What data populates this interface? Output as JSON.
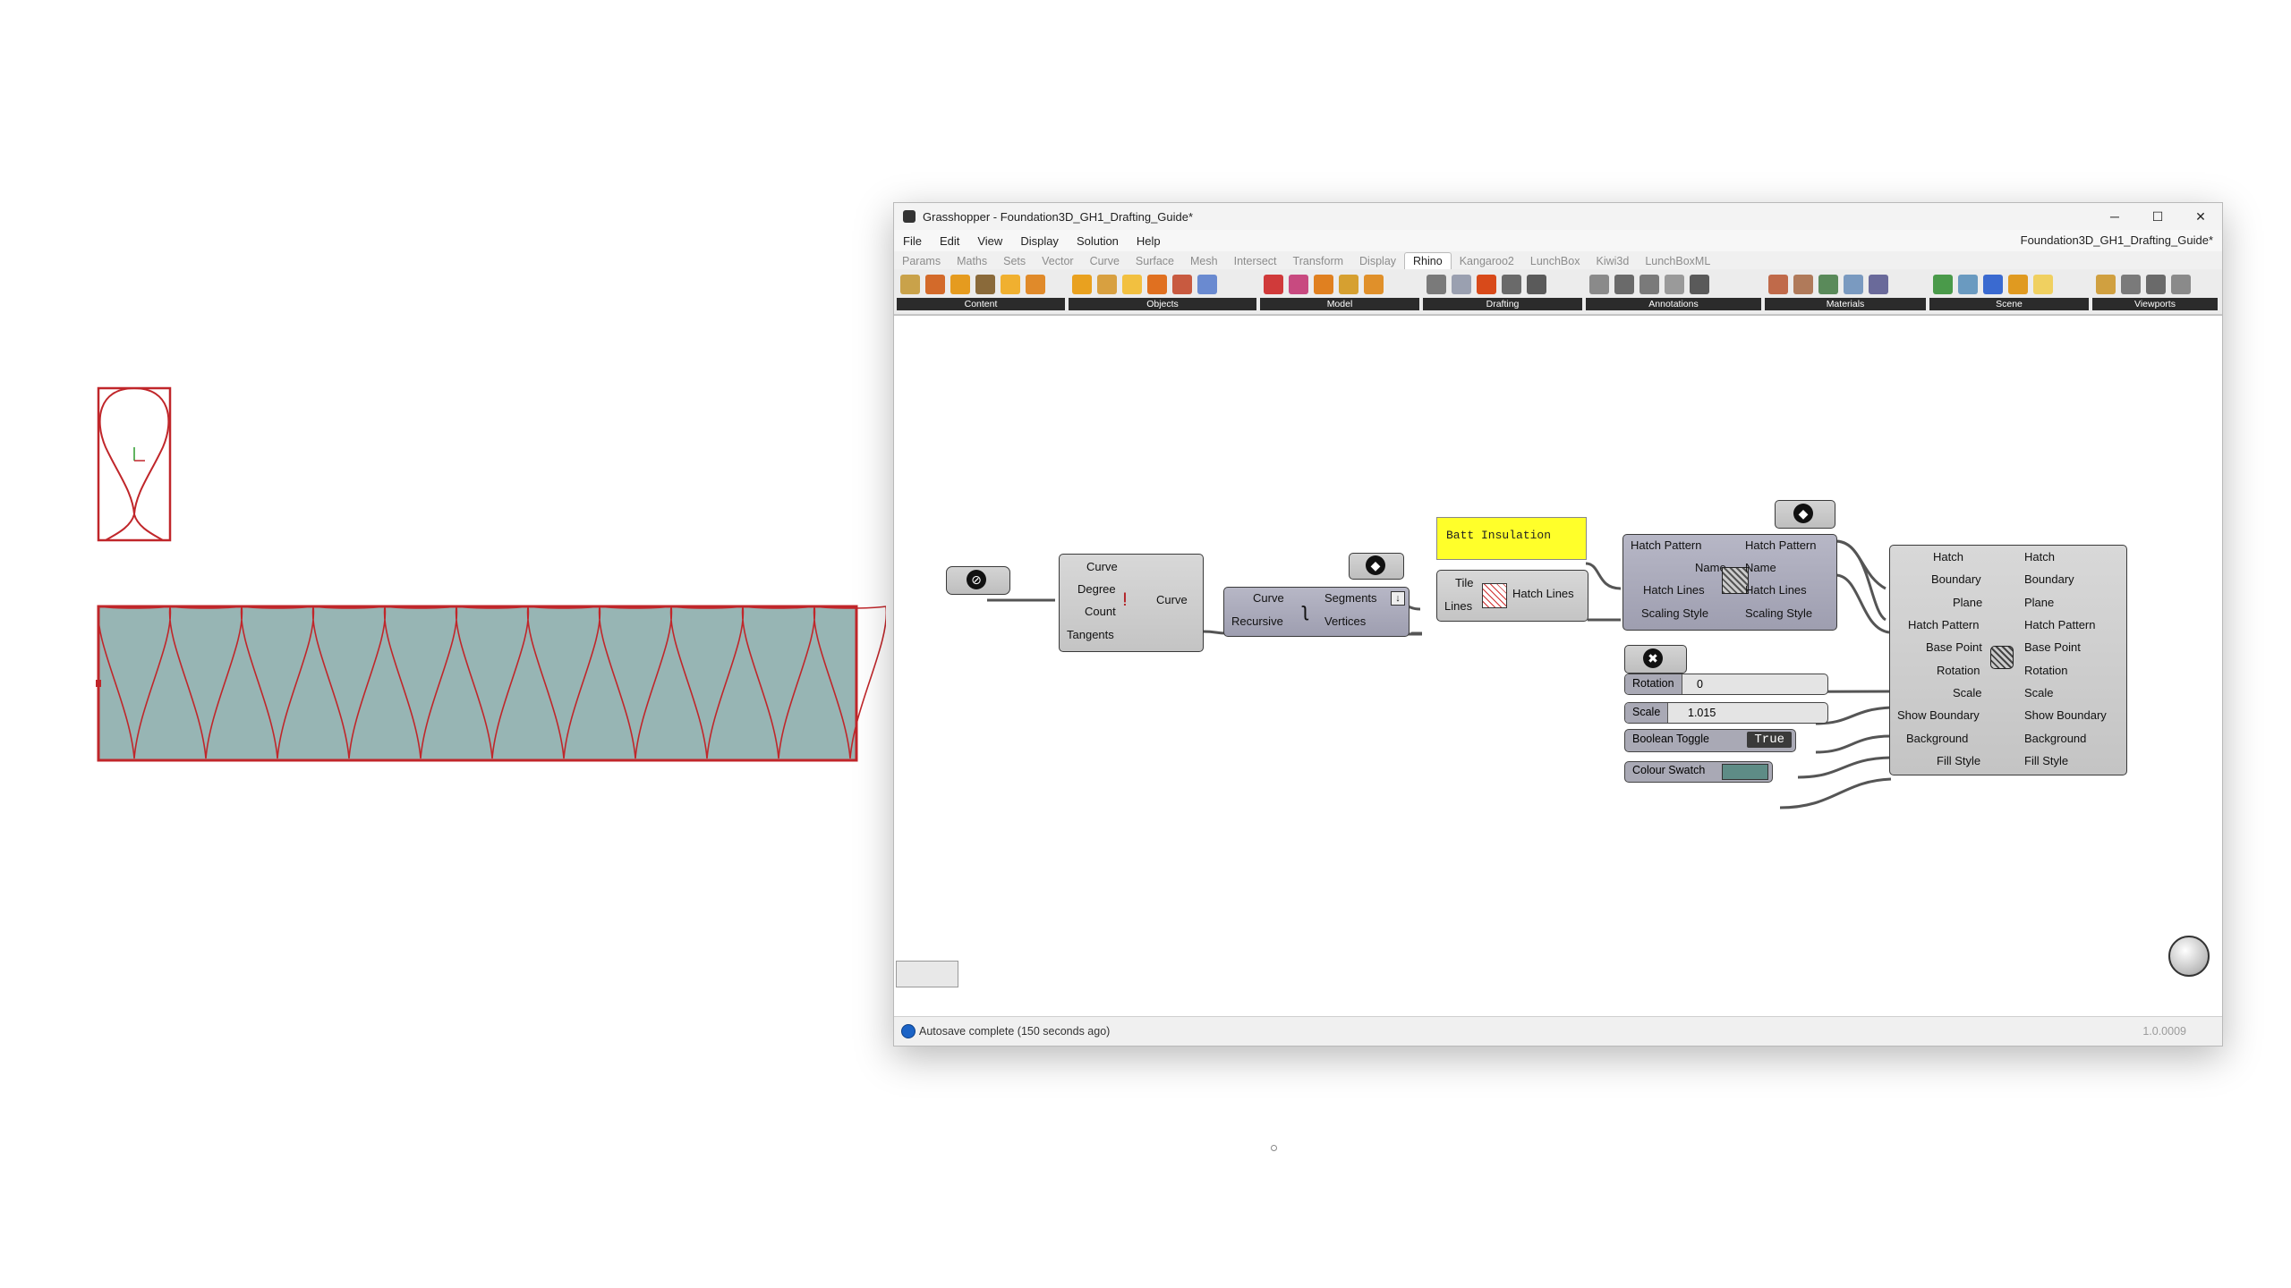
{
  "window": {
    "title": "Grasshopper - Foundation3D_GH1_Drafting_Guide*",
    "doc_name": "Foundation3D_GH1_Drafting_Guide*",
    "controls": {
      "minimize": "─",
      "maximize": "☐",
      "close": "✕"
    }
  },
  "menu": [
    "File",
    "Edit",
    "View",
    "Display",
    "Solution",
    "Help"
  ],
  "tabs": [
    "Params",
    "Maths",
    "Sets",
    "Vector",
    "Curve",
    "Surface",
    "Mesh",
    "Intersect",
    "Transform",
    "Display",
    "Rhino",
    "Kangaroo2",
    "LunchBox",
    "Kiwi3d",
    "LunchBoxML"
  ],
  "active_tab": "Rhino",
  "toolbar_groups": [
    "Content",
    "Objects",
    "Model",
    "Drafting",
    "Annotations",
    "Materials",
    "Scene",
    "Viewports"
  ],
  "canvas": {
    "panel_text": "Batt Insulation",
    "nurbs": {
      "inputs": [
        "Curve",
        "Degree",
        "Count",
        "Tangents"
      ],
      "output": "Curve"
    },
    "explode": {
      "inputs": [
        "Curve",
        "Recursive"
      ],
      "outputs": [
        "Segments",
        "Vertices"
      ]
    },
    "hatch_lines": {
      "inputs": [
        "Tile",
        "Lines"
      ],
      "output": "Hatch Lines"
    },
    "hatch_pattern": {
      "inputs": [
        "Hatch Pattern",
        "Name",
        "Hatch Lines",
        "Scaling Style"
      ],
      "outputs": [
        "Hatch Pattern",
        "Name",
        "Hatch Lines",
        "Scaling Style"
      ]
    },
    "model_hatch": {
      "inputs": [
        "Hatch",
        "Boundary",
        "Plane",
        "Hatch Pattern",
        "Base Point",
        "Rotation",
        "Scale",
        "Show Boundary",
        "Background",
        "Fill Style"
      ],
      "outputs": [
        "Hatch",
        "Boundary",
        "Plane",
        "Hatch Pattern",
        "Base Point",
        "Rotation",
        "Scale",
        "Show Boundary",
        "Background",
        "Fill Style"
      ]
    },
    "slider_rotation": {
      "name": "Rotation",
      "value": "0"
    },
    "slider_scale": {
      "name": "Scale",
      "value": "1.015"
    },
    "toggle": {
      "name": "Boolean Toggle",
      "value": "True"
    },
    "swatch": {
      "name": "Colour Swatch",
      "color": "#5e8c86"
    }
  },
  "status": {
    "text": "Autosave complete (150 seconds ago)",
    "version": "1.0.0009"
  },
  "colors": {
    "hatch_fill": "#97b5b4",
    "hatch_line": "#c0262a"
  }
}
